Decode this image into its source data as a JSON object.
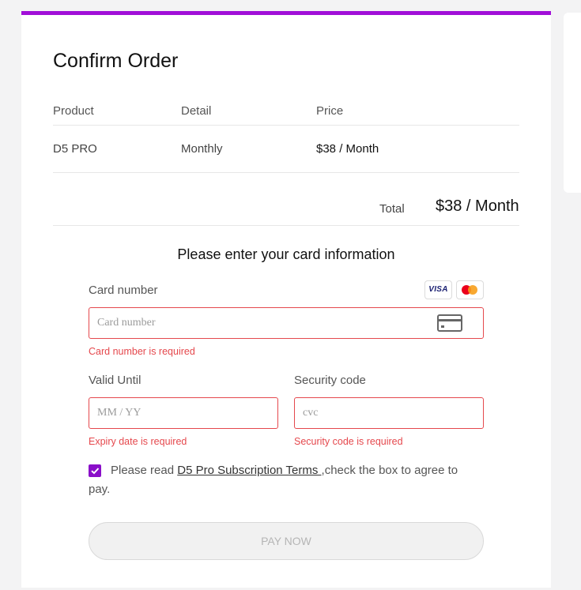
{
  "order": {
    "title": "Confirm Order",
    "columns": [
      "Product",
      "Detail",
      "Price"
    ],
    "row": {
      "product": "D5 PRO",
      "detail": "Monthly",
      "price": "$38 / Month"
    },
    "total_label": "Total",
    "total_value": "$38 / Month"
  },
  "card_form": {
    "section_title": "Please enter your card information",
    "card_number_label": "Card number",
    "card_brands": [
      "VISA",
      "mastercard"
    ],
    "card_number_placeholder": "Card number",
    "card_number_error": "Card number is required",
    "valid_until_label": "Valid Until",
    "valid_until_placeholder": "MM / YY",
    "valid_until_error": "Expiry date is required",
    "security_code_label": "Security code",
    "security_code_placeholder": "cvc",
    "security_code_error": "Security code is required"
  },
  "agreement": {
    "checked": true,
    "prefix": "Please read ",
    "link_text": "D5 Pro Subscription Terms ",
    "suffix": ",check the box to agree to pay."
  },
  "pay_button": {
    "label": "PAY NOW",
    "disabled": true
  },
  "colors": {
    "accent": "#a10fd8",
    "checkbox": "#8a0fc9",
    "error": "#e5484d"
  }
}
